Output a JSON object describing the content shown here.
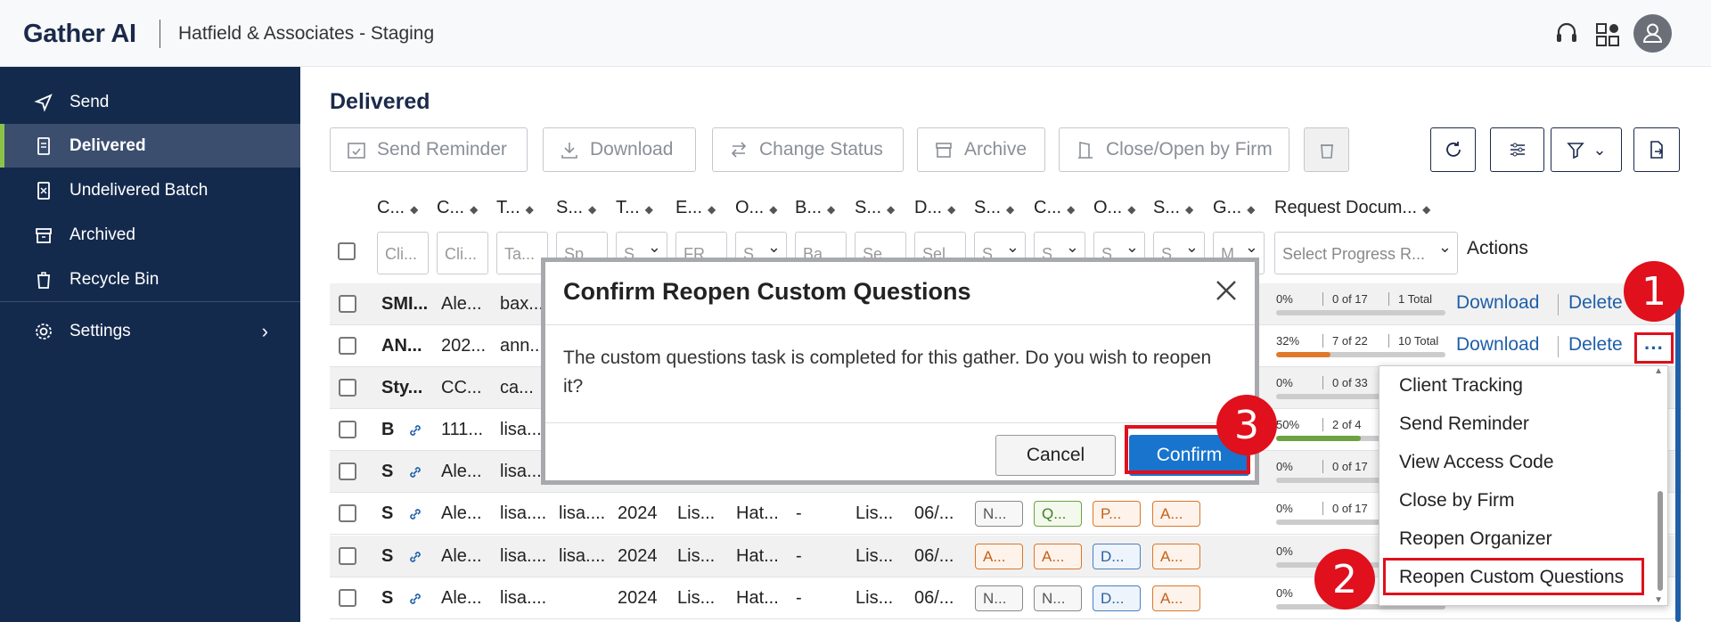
{
  "topbar": {
    "brand": "Gather AI",
    "workspace": "Hatfield & Associates - Staging"
  },
  "sidebar": {
    "items": [
      {
        "label": "Send",
        "icon": "send-icon"
      },
      {
        "label": "Delivered",
        "icon": "document-icon"
      },
      {
        "label": "Undelivered Batch",
        "icon": "batch-icon"
      },
      {
        "label": "Archived",
        "icon": "archive-icon"
      },
      {
        "label": "Recycle Bin",
        "icon": "trash-icon"
      },
      {
        "label": "Settings",
        "icon": "gear-icon"
      }
    ],
    "active": "Delivered"
  },
  "main": {
    "title": "Delivered",
    "toolbar": {
      "send_reminder": "Send Reminder",
      "download": "Download",
      "change_status": "Change Status",
      "archive": "Archive",
      "close_open": "Close/Open by Firm"
    },
    "columns": [
      "C...",
      "C...",
      "T...",
      "S...",
      "T...",
      "E...",
      "O...",
      "B...",
      "S...",
      "D...",
      "S...",
      "C...",
      "O...",
      "S...",
      "G...",
      "Request Docum..."
    ],
    "filters": [
      "Cli...",
      "Cli...",
      "Ta...",
      "Sp...",
      "S...",
      "FR...",
      "S...",
      "Ba...",
      "Se...",
      "Sel...",
      "S...",
      "S...",
      "S...",
      "S...",
      "M...",
      "Select Progress R..."
    ],
    "actions_header": "Actions",
    "rows": [
      {
        "c1": "SMI...",
        "c2": "Ale...",
        "c3": "bax...",
        "pct": "0%",
        "cnt": "0 of 17",
        "tot": "1 Total",
        "fill": 0,
        "fill_color": "#cccccc"
      },
      {
        "c1": "AN...",
        "c2": "202...",
        "c3": "ann...",
        "pct": "32%",
        "cnt": "7 of 22",
        "tot": "10 Total",
        "fill": 0.32,
        "fill_color": "#e07a2a"
      },
      {
        "c1": "Sty...",
        "c2": "CC...",
        "c3": "ca...",
        "pct": "0%",
        "cnt": "0 of 33",
        "tot": "",
        "fill": 0,
        "fill_color": "#cccccc"
      },
      {
        "c1": "B",
        "c2": "111...",
        "c3": "lisa...",
        "pct": "50%",
        "cnt": "2 of 4",
        "tot": "",
        "fill": 0.5,
        "fill_color": "#6ca23f"
      },
      {
        "c1": "S",
        "c2": "Ale...",
        "c3": "lisa...",
        "pct": "0%",
        "cnt": "0 of 17",
        "tot": "",
        "fill": 0,
        "fill_color": "#cccccc"
      },
      {
        "c1": "S",
        "c2": "Ale...",
        "c3": "lisa....",
        "c4": "lisa....",
        "c5": "2024",
        "c6": "Lis...",
        "c7": "Hat...",
        "c8": "-",
        "c9": "Lis...",
        "c10": "06/...",
        "b1": "N...",
        "b2": "Q...",
        "b3": "P...",
        "b4": "A...",
        "pct": "0%",
        "cnt": "0 of 17",
        "tot": "",
        "fill": 0,
        "fill_color": "#cccccc"
      },
      {
        "c1": "S",
        "c2": "Ale...",
        "c3": "lisa....",
        "c4": "lisa....",
        "c5": "2024",
        "c6": "Lis...",
        "c7": "Hat...",
        "c8": "-",
        "c9": "Lis...",
        "c10": "06/...",
        "b1": "A...",
        "b2": "A...",
        "b3": "D...",
        "b4": "A...",
        "pct": "0%",
        "cnt": "",
        "tot": "",
        "fill": 0,
        "fill_color": "#cccccc"
      },
      {
        "c1": "S",
        "c2": "Ale...",
        "c3": "lisa....",
        "c4": "",
        "c5": "2024",
        "c6": "Lis...",
        "c7": "Hat...",
        "c8": "-",
        "c9": "Lis...",
        "c10": "06/...",
        "b1": "N...",
        "b2": "N...",
        "b3": "D...",
        "b4": "A...",
        "pct": "0%",
        "cnt": "",
        "tot": "",
        "fill": 0,
        "fill_color": "#cccccc"
      }
    ],
    "row_actions": {
      "download": "Download",
      "delete": "Delete"
    }
  },
  "menu": {
    "items": [
      "Client Tracking",
      "Send Reminder",
      "View Access Code",
      "Close by Firm",
      "Reopen Organizer",
      "Reopen Custom Questions"
    ]
  },
  "modal": {
    "title": "Confirm Reopen Custom Questions",
    "body": "The custom questions task is completed for this gather. Do you wish to reopen it?",
    "cancel": "Cancel",
    "confirm": "Confirm"
  },
  "steps": [
    "1",
    "2",
    "3"
  ],
  "colors": {
    "sidebar": "#142a4d",
    "accent": "#1874cd",
    "highlight": "#e0101c",
    "active_bar": "#8bc34a"
  }
}
